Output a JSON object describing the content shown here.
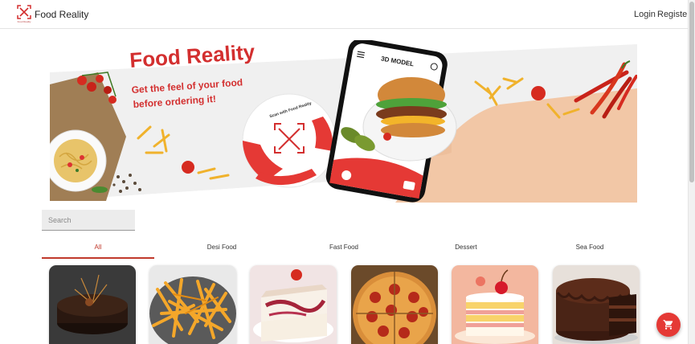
{
  "header": {
    "brand": "Food Reality",
    "logo_caption": "Food Reality",
    "nav": {
      "login": "Login",
      "register": "Register"
    }
  },
  "banner": {
    "title": "Food Reality",
    "tagline_line1": "Get the feel of your food",
    "tagline_line2": "before ordering it!",
    "phone_screen_title": "3D MODEL",
    "scan_badge_text": "Scan with Food Reality"
  },
  "search": {
    "placeholder": "Search",
    "value": ""
  },
  "categories": [
    {
      "label": "All",
      "active": true
    },
    {
      "label": "Desi Food",
      "active": false
    },
    {
      "label": "Fast Food",
      "active": false
    },
    {
      "label": "Dessert",
      "active": false
    },
    {
      "label": "Sea Food",
      "active": false
    }
  ],
  "products": [
    {
      "name": "chocolate-mousse-cake",
      "bg": "#3a3a3a"
    },
    {
      "name": "french-fries",
      "bg": "#f4a72a"
    },
    {
      "name": "strawberry-cheesecake",
      "bg": "#f1e4e4"
    },
    {
      "name": "pepperoni-pizza",
      "bg": "#b9833e"
    },
    {
      "name": "strawberry-cream-cake",
      "bg": "#f3b79f"
    },
    {
      "name": "chocolate-layer-cake",
      "bg": "#e7e0da"
    }
  ],
  "colors": {
    "accent": "#c0392b",
    "cart_button": "#e53935"
  },
  "icons": {
    "logo": "scan-frame-fork-knife-icon",
    "cart": "shopping-cart-icon"
  }
}
